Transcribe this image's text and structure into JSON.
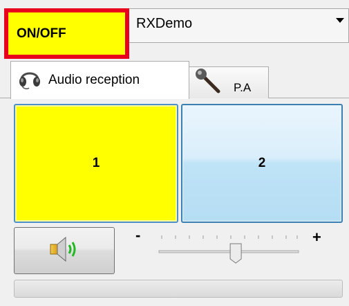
{
  "onoff": {
    "label": "ON/OFF"
  },
  "receiver_select": {
    "value": "RXDemo"
  },
  "tabs": [
    {
      "label": "Audio reception",
      "icon": "headphones-icon",
      "selected": true
    },
    {
      "label": "P.A",
      "icon": "microphone-icon",
      "selected": false
    }
  ],
  "channels": [
    {
      "label": "1",
      "active": true
    },
    {
      "label": "2",
      "active": false
    }
  ],
  "volume": {
    "minus_label": "-",
    "plus_label": "+",
    "level": 0.55
  },
  "speaker": {
    "icon": "speaker-icon"
  },
  "progress": {
    "value": 0
  },
  "colors": {
    "onoff_bg": "#ffff00",
    "onoff_border": "#e8001c",
    "channel_active": "#ffff00",
    "channel_inactive": "#c6e6f8"
  }
}
